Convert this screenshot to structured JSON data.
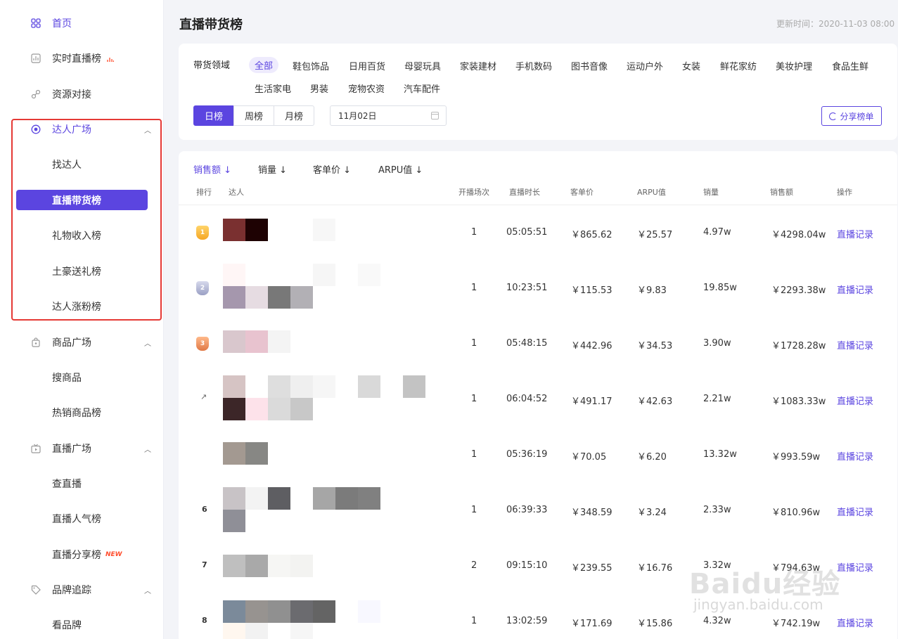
{
  "sidebar": {
    "items": [
      {
        "label": "首页",
        "icon": "grid-icon",
        "type": "top",
        "active": true
      },
      {
        "label": "实时直播榜",
        "icon": "chart-icon",
        "type": "top",
        "hot": true
      },
      {
        "label": "资源对接",
        "icon": "link-icon",
        "type": "top"
      },
      {
        "label": "达人广场",
        "icon": "user-circle-icon",
        "type": "group",
        "expanded": true
      },
      {
        "label": "找达人",
        "type": "sub"
      },
      {
        "label": "直播带货榜",
        "type": "sub",
        "active": true
      },
      {
        "label": "礼物收入榜",
        "type": "sub"
      },
      {
        "label": "土豪送礼榜",
        "type": "sub"
      },
      {
        "label": "达人涨粉榜",
        "type": "sub"
      },
      {
        "label": "商品广场",
        "icon": "bag-icon",
        "type": "group",
        "expanded": true
      },
      {
        "label": "搜商品",
        "type": "sub"
      },
      {
        "label": "热销商品榜",
        "type": "sub"
      },
      {
        "label": "直播广场",
        "icon": "tv-icon",
        "type": "group",
        "expanded": true
      },
      {
        "label": "查直播",
        "type": "sub"
      },
      {
        "label": "直播人气榜",
        "type": "sub"
      },
      {
        "label": "直播分享榜",
        "type": "sub",
        "badge": "NEW"
      },
      {
        "label": "品牌追踪",
        "icon": "tag-icon",
        "type": "group",
        "expanded": true
      },
      {
        "label": "看品牌",
        "type": "sub"
      }
    ]
  },
  "header": {
    "title": "直播带货榜",
    "update_time": "更新时间：2020-11-03 08:00"
  },
  "filters": {
    "label": "带货领域",
    "categories": [
      "全部",
      "鞋包饰品",
      "日用百货",
      "母婴玩具",
      "家装建材",
      "手机数码",
      "图书音像",
      "运动户外",
      "女装",
      "鲜花家纺",
      "美妆护理",
      "食品生鲜",
      "生活家电",
      "男装",
      "宠物农资",
      "汽车配件"
    ],
    "active_category": "全部",
    "periods": [
      "日榜",
      "周榜",
      "月榜"
    ],
    "active_period": "日榜",
    "date": "11月02日",
    "share_label": "分享榜单"
  },
  "table": {
    "sort_options": [
      "销售额 ↓",
      "销量 ↓",
      "客单价 ↓",
      "ARPU值 ↓"
    ],
    "active_sort": "销售额 ↓",
    "columns": [
      "排行",
      "达人",
      "开播场次",
      "直播时长",
      "客单价",
      "ARPU值",
      "销量",
      "销售额",
      "操作"
    ],
    "rows": [
      {
        "rank": "1",
        "sessions": "1",
        "duration": "05:05:51",
        "unit_price": "￥865.62",
        "arpu": "￥25.57",
        "volume": "4.97w",
        "sales": "￥4298.04w",
        "action": "直播记录"
      },
      {
        "rank": "2",
        "sessions": "1",
        "duration": "10:23:51",
        "unit_price": "￥115.53",
        "arpu": "￥9.83",
        "volume": "19.85w",
        "sales": "￥2293.38w",
        "action": "直播记录"
      },
      {
        "rank": "3",
        "sessions": "1",
        "duration": "05:48:15",
        "unit_price": "￥442.96",
        "arpu": "￥34.53",
        "volume": "3.90w",
        "sales": "￥1728.28w",
        "action": "直播记录"
      },
      {
        "rank": "↗",
        "sessions": "1",
        "duration": "06:04:52",
        "unit_price": "￥491.17",
        "arpu": "￥42.63",
        "volume": "2.21w",
        "sales": "￥1083.33w",
        "action": "直播记录"
      },
      {
        "rank": "",
        "sessions": "1",
        "duration": "05:36:19",
        "unit_price": "￥70.05",
        "arpu": "￥6.20",
        "volume": "13.32w",
        "sales": "￥993.59w",
        "action": "直播记录"
      },
      {
        "rank": "6",
        "sessions": "1",
        "duration": "06:39:33",
        "unit_price": "￥348.59",
        "arpu": "￥3.24",
        "volume": "2.33w",
        "sales": "￥810.96w",
        "action": "直播记录"
      },
      {
        "rank": "7",
        "sessions": "2",
        "duration": "09:15:10",
        "unit_price": "￥239.55",
        "arpu": "￥16.76",
        "volume": "3.32w",
        "sales": "￥794.63w",
        "action": "直播记录"
      },
      {
        "rank": "8",
        "sessions": "1",
        "duration": "13:02:59",
        "unit_price": "￥171.69",
        "arpu": "￥15.86",
        "volume": "4.32w",
        "sales": "￥742.19w",
        "action": "直播记录"
      }
    ]
  },
  "watermark": {
    "main": "Baidu经验",
    "sub": "jingyan.baidu.com"
  },
  "colors": {
    "accent": "#5b45e0",
    "frame": "#e53935",
    "badge_new": "#ff4d2d"
  }
}
